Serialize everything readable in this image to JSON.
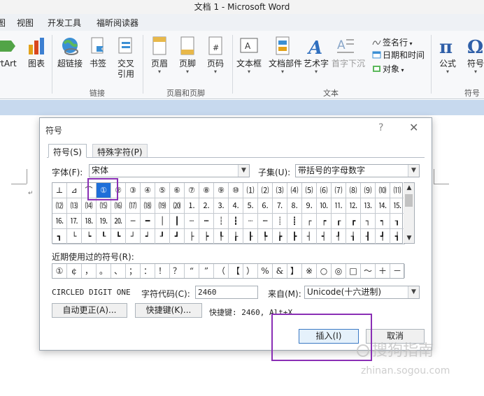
{
  "window": {
    "title": "文档 1 - Microsoft Word"
  },
  "menu": {
    "tabs": [
      "图",
      "视图",
      "开发工具",
      "福昕阅读器"
    ]
  },
  "ribbon": {
    "buttons": [
      {
        "label": "rtArt",
        "icon": "smartart-icon"
      },
      {
        "label": "图表",
        "icon": "chart-icon"
      },
      {
        "label": "超链接",
        "icon": "hyperlink-icon"
      },
      {
        "label": "书签",
        "icon": "bookmark-icon"
      },
      {
        "label": "交叉",
        "label2": "引用",
        "icon": "cross-reference-icon"
      },
      {
        "label": "页眉",
        "icon": "header-icon"
      },
      {
        "label": "页脚",
        "icon": "footer-icon"
      },
      {
        "label": "页码",
        "icon": "page-number-icon"
      },
      {
        "label": "文本框",
        "icon": "textbox-icon"
      },
      {
        "label": "文档部件",
        "icon": "quick-parts-icon"
      },
      {
        "label": "艺术字",
        "icon": "wordart-icon"
      },
      {
        "label": "首字下沉",
        "icon": "dropcap-icon"
      },
      {
        "label": "公式",
        "icon": "equation-icon"
      },
      {
        "label": "符号",
        "icon": "symbol-icon"
      }
    ],
    "small_commands": [
      {
        "label": "签名行",
        "icon": "signature-line-icon"
      },
      {
        "label": "日期和时间",
        "icon": "date-time-icon"
      },
      {
        "label": "对象",
        "icon": "object-icon"
      }
    ],
    "groups": [
      "链接",
      "页眉和页脚",
      "文本",
      "符号"
    ]
  },
  "dialog": {
    "title": "符号",
    "help": "?",
    "close": "✕",
    "tabs": [
      {
        "label": "符号(S)",
        "active": true
      },
      {
        "label": "特殊字符(P)",
        "active": false
      }
    ],
    "font_label": "字体(F):",
    "font_value": "宋体",
    "subset_label": "子集(U):",
    "subset_value": "带括号的字母数字",
    "grid_rows": [
      [
        "⊥",
        "⊿",
        "⌒",
        "①",
        "②",
        "③",
        "④",
        "⑤",
        "⑥",
        "⑦",
        "⑧",
        "⑨",
        "⑩",
        "⑴",
        "⑵",
        "⑶",
        "⑷",
        "⑸",
        "⑹",
        "⑺",
        "⑻",
        "⑼",
        "⑽",
        "⑾"
      ],
      [
        "⑿",
        "⒀",
        "⒁",
        "⒂",
        "⒃",
        "⒄",
        "⒅",
        "⒆",
        "⒇",
        "⒈",
        "⒉",
        "⒊",
        "⒋",
        "⒌",
        "⒍",
        "⒎",
        "⒏",
        "⒐",
        "⒑",
        "⒒",
        "⒓",
        "⒔",
        "⒕",
        "⒖"
      ],
      [
        "⒗",
        "⒘",
        "⒙",
        "⒚",
        "⒛",
        "─",
        "━",
        "│",
        "┃",
        "┄",
        "┅",
        "┆",
        "┇",
        "┈",
        "┉",
        "┊",
        "┋",
        "┌",
        "┍",
        "┎",
        "┏",
        "┐",
        "┑",
        "┒"
      ],
      [
        "┓",
        "└",
        "┕",
        "┖",
        "┗",
        "┘",
        "┙",
        "┚",
        "┛",
        "├",
        "┝",
        "┞",
        "┟",
        "┠",
        "┡",
        "┢",
        "┣",
        "┤",
        "┥",
        "┦",
        "┧",
        "┨",
        "┩",
        "┪"
      ]
    ],
    "selected_symbol": "①",
    "recent_label": "近期使用过的符号(R):",
    "recent_symbols": [
      "①",
      "¢",
      "，",
      "。",
      "、",
      "；",
      "：",
      "！",
      "？",
      "“",
      "”",
      "（",
      "【",
      "）",
      "%",
      "&",
      "】",
      "※",
      "○",
      "◎",
      "□",
      "～",
      "＋",
      "－"
    ],
    "char_name": "CIRCLED DIGIT ONE",
    "char_code_label": "字符代码(C):",
    "char_code_value": "2460",
    "from_label": "来自(M):",
    "from_value": "Unicode(十六进制)",
    "autocorrect_button": "自动更正(A)...",
    "shortcut_key_button": "快捷键(K)...",
    "shortcut_info": "快捷键: 2460, Alt+X",
    "insert_button": "插入(I)",
    "cancel_button": "取消"
  },
  "watermark": {
    "logo_text": "搜狗指南",
    "url": "zhinan.sogou.com"
  },
  "colors": {
    "highlight": "#8a2fb5",
    "selected_cell": "#1e6fd9",
    "ribbon_band": "#c7d9ee"
  }
}
